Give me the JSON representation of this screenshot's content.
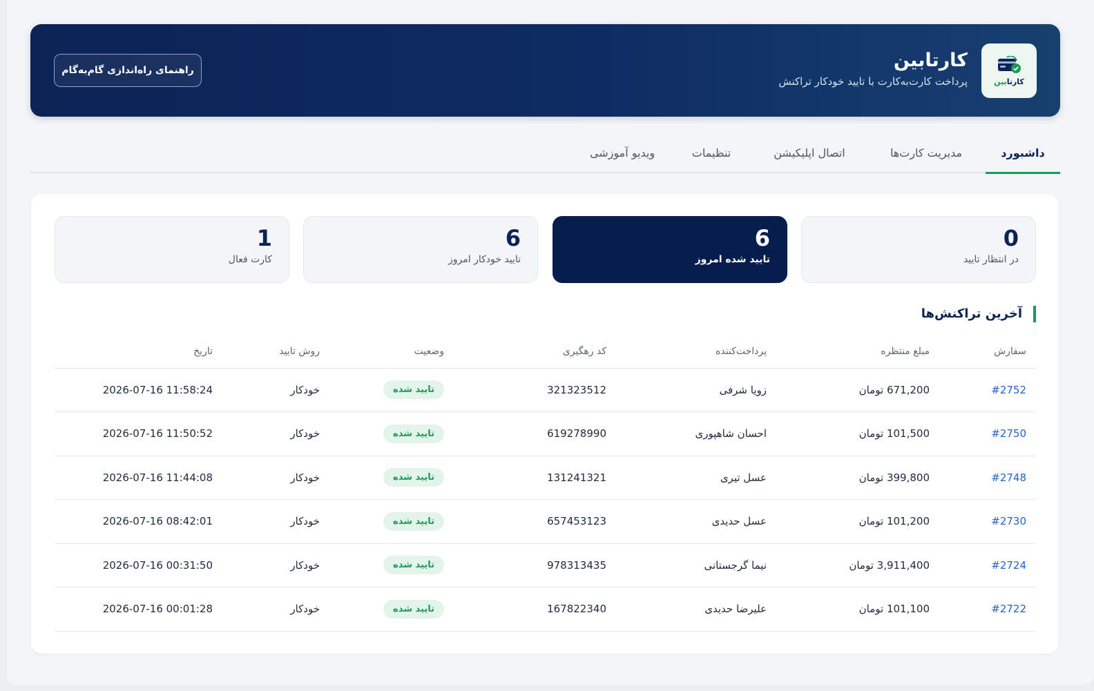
{
  "header": {
    "logo_text_a": "کارتا",
    "logo_text_b": "بین",
    "title": "کارتابین",
    "subtitle": "پرداخت کارت‌به‌کارت با تایید خودکار تراکنش",
    "guide_button": "راهنمای راه‌اندازی گام‌به‌گام",
    "logo_icon": "card-icon"
  },
  "tabs": [
    {
      "label": "داشبورد",
      "active": true
    },
    {
      "label": "مدیریت کارت‌ها"
    },
    {
      "label": "اتصال اپلیکیشن"
    },
    {
      "label": "تنظیمات"
    },
    {
      "label": "ویدیو آموزشی"
    }
  ],
  "stats": [
    {
      "value": "0",
      "label": "در انتظار تایید"
    },
    {
      "value": "6",
      "label": "تایید شده امروز"
    },
    {
      "value": "6",
      "label": "تایید خودکار امروز"
    },
    {
      "value": "1",
      "label": "کارت فعال"
    }
  ],
  "transactions": {
    "title": "آخرین تراکنش‌ها",
    "columns": [
      "سفارش",
      "مبلغ منتظره",
      "پرداخت‌کننده",
      "کد رهگیری",
      "وضعیت",
      "روش تایید",
      "تاریخ"
    ],
    "rows": [
      {
        "order": "#2752",
        "amount": "671,200",
        "currency": "تومان",
        "payer": "زویا شرفی",
        "code": "321323512",
        "status": "تایید شده",
        "method": "خودکار",
        "date": "2026-07-16 11:58:24"
      },
      {
        "order": "#2750",
        "amount": "101,500",
        "currency": "تومان",
        "payer": "احسان شاهپوری",
        "code": "619278990",
        "status": "تایید شده",
        "method": "خودکار",
        "date": "2026-07-16 11:50:52"
      },
      {
        "order": "#2748",
        "amount": "399,800",
        "currency": "تومان",
        "payer": "عسل تیری",
        "code": "131241321",
        "status": "تایید شده",
        "method": "خودکار",
        "date": "2026-07-16 11:44:08"
      },
      {
        "order": "#2730",
        "amount": "101,200",
        "currency": "تومان",
        "payer": "عسل حدیدی",
        "code": "657453123",
        "status": "تایید شده",
        "method": "خودکار",
        "date": "2026-07-16 08:42:01"
      },
      {
        "order": "#2724",
        "amount": "3,911,400",
        "currency": "تومان",
        "payer": "نیما گرجستانی",
        "code": "978313435",
        "status": "تایید شده",
        "method": "خودکار",
        "date": "2026-07-16 00:31:50"
      },
      {
        "order": "#2722",
        "amount": "101,100",
        "currency": "تومان",
        "payer": "علیرضا حدیدی",
        "code": "167822340",
        "status": "تایید شده",
        "method": "خودکار",
        "date": "2026-07-16 00:01:28"
      }
    ]
  },
  "colors": {
    "navy": "#0c2356",
    "accent_green": "#1a9a55",
    "link_blue": "#2563c9",
    "badge_bg": "#e3f5ea"
  }
}
